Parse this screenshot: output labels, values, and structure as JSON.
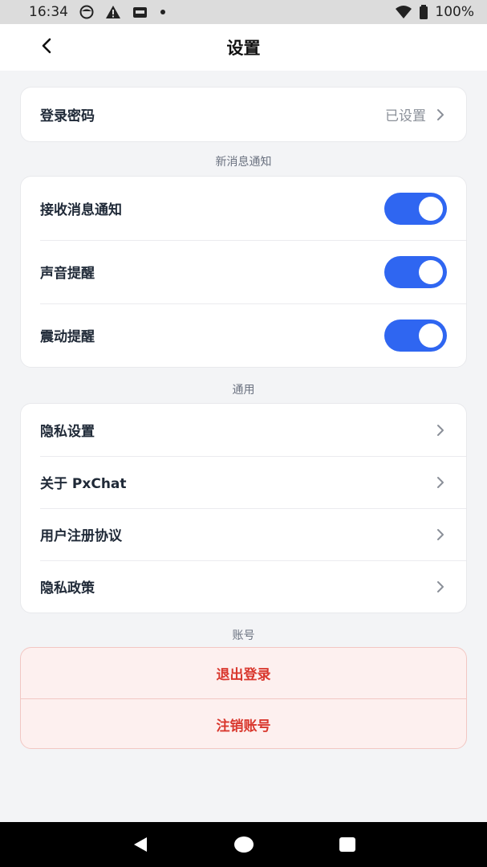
{
  "status_bar": {
    "time": "16:34",
    "battery": "100%",
    "icons": [
      "face-icon",
      "warning-icon",
      "app-icon",
      "dot-icon",
      "wifi-icon",
      "battery-icon"
    ]
  },
  "header": {
    "title": "设置",
    "back_icon": "chevron-left-icon"
  },
  "password_row": {
    "label": "登录密码",
    "value": "已设置"
  },
  "sections": {
    "notifications": "新消息通知",
    "general": "通用",
    "account": "账号"
  },
  "notifications": [
    {
      "label": "接收消息通知",
      "enabled": true
    },
    {
      "label": "声音提醒",
      "enabled": true
    },
    {
      "label": "震动提醒",
      "enabled": true
    }
  ],
  "general": [
    {
      "label": "隐私设置"
    },
    {
      "label": "关于 PxChat"
    },
    {
      "label": "用户注册协议"
    },
    {
      "label": "隐私政策"
    }
  ],
  "account": {
    "logout": "退出登录",
    "delete": "注销账号"
  },
  "colors": {
    "accent": "#2f66f1",
    "danger": "#d9382e",
    "danger_bg": "#fdf0ef",
    "background": "#f3f4f6"
  }
}
